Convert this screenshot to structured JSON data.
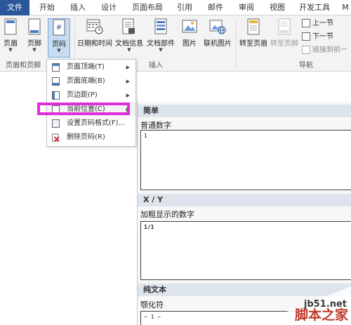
{
  "tabs": [
    "文件",
    "开始",
    "插入",
    "设计",
    "页面布局",
    "引用",
    "邮件",
    "审阅",
    "视图",
    "开发工具",
    "M"
  ],
  "ribbon": {
    "header": "页眉",
    "footer": "页脚",
    "page_number": "页码",
    "date_time": "日期和时间",
    "doc_info": "文档信息",
    "doc_parts": "文档部件",
    "picture": "图片",
    "online_picture": "联机图片",
    "goto_header": "转至页眉",
    "goto_footer": "转至页脚",
    "prev_section": "上一节",
    "next_section": "下一节",
    "link_previous": "链接到前一",
    "group_header_footer": "页眉和页脚",
    "group_insert": "插入",
    "group_navigation": "导航"
  },
  "menu": {
    "items": [
      {
        "label": "页面顶端(T)",
        "submenu": true
      },
      {
        "label": "页面底端(B)",
        "submenu": true
      },
      {
        "label": "页边距(P)",
        "submenu": true
      },
      {
        "label": "当前位置(C)",
        "submenu": true
      },
      {
        "label": "设置页码格式(F)...",
        "submenu": false
      },
      {
        "label": "删除页码(R)",
        "submenu": false
      }
    ]
  },
  "gallery": {
    "sections": [
      {
        "heading": "简单",
        "item_title": "普通数字",
        "preview": "1"
      },
      {
        "heading": "X / Y",
        "item_title": "加粗显示的数字",
        "preview": "1/1"
      },
      {
        "heading": "纯文本",
        "item_title": "颚化符",
        "preview": "~ 1 ~"
      }
    ]
  },
  "watermark": {
    "site": "jb51.net",
    "brand": "脚本之家"
  },
  "colors": {
    "file_tab": "#2b579a",
    "highlight": "#e02ddb",
    "ribbon_bg": "#f3f3f3",
    "gallery_header": "#dde4ec"
  }
}
